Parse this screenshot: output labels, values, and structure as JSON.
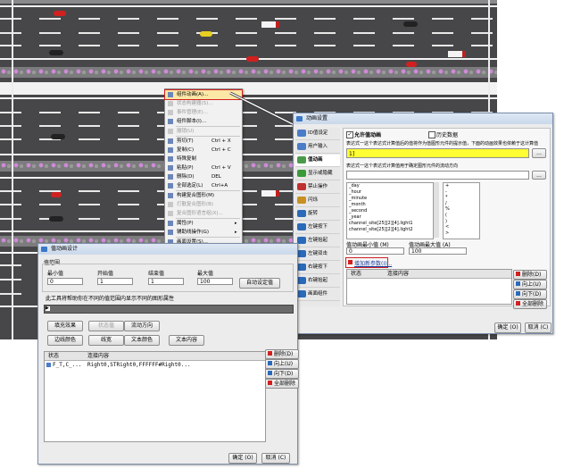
{
  "context_menu": {
    "items": [
      {
        "label": "组件动画(A)...",
        "shortcut": "",
        "enabled": true,
        "highlighted": true
      },
      {
        "label": "状态构建器(S)...",
        "shortcut": "",
        "enabled": false
      },
      {
        "label": "事件管理(E)...",
        "shortcut": "",
        "enabled": false
      },
      {
        "label": "组件脚本(I)...",
        "shortcut": "",
        "enabled": true
      },
      {
        "label": "撤销(U)",
        "shortcut": "",
        "enabled": false
      },
      {
        "label": "剪切(T)",
        "shortcut": "Ctrl + X",
        "enabled": true
      },
      {
        "label": "复制(C)",
        "shortcut": "Ctrl + C",
        "enabled": true
      },
      {
        "label": "特殊复制",
        "shortcut": "",
        "enabled": true
      },
      {
        "label": "粘贴(P)",
        "shortcut": "Ctrl + V",
        "enabled": true
      },
      {
        "label": "删除(D)",
        "shortcut": "DEL",
        "enabled": true
      },
      {
        "label": "全部选定(L)",
        "shortcut": "Ctrl+A",
        "enabled": true
      },
      {
        "label": "构建复合图形(M)",
        "shortcut": "",
        "enabled": true
      },
      {
        "label": "打散复合图形(B)",
        "shortcut": "",
        "enabled": false
      },
      {
        "label": "复合图形语言组(X)...",
        "shortcut": "",
        "enabled": false
      },
      {
        "label": "属性(P)",
        "shortcut": "",
        "enabled": true,
        "submenu": true
      },
      {
        "label": "辅助线操作(G)",
        "shortcut": "",
        "enabled": true,
        "submenu": true
      },
      {
        "label": "画面设置(S)...",
        "shortcut": "",
        "enabled": true
      }
    ]
  },
  "anim_dialog": {
    "title": "动画设置",
    "nav_items": [
      {
        "label": "ID值设定",
        "color": "#4a7cc8"
      },
      {
        "label": "用户输入",
        "color": "#4a7cc8"
      },
      {
        "label": "值动画",
        "color": "#4a9a4a",
        "selected": true
      },
      {
        "label": "显示或隐藏",
        "color": "#3a9a3a"
      },
      {
        "label": "禁止操作",
        "color": "#c03030"
      },
      {
        "label": "闪烁",
        "color": "#c89020"
      },
      {
        "label": "旋转",
        "color": "#2a6ab8"
      },
      {
        "label": "左键按下",
        "color": "#2a6ab8"
      },
      {
        "label": "左键抬起",
        "color": "#2a6ab8"
      },
      {
        "label": "左键双击",
        "color": "#2a6ab8"
      },
      {
        "label": "右键按下",
        "color": "#2a6ab8"
      },
      {
        "label": "右键抬起",
        "color": "#2a6ab8"
      },
      {
        "label": "画面组件",
        "color": "#2a6ab8"
      }
    ],
    "allow_label": "允许值动画",
    "history_label": "历史数据",
    "expr_label": "表达式一这个表达式计算值后的值将作为值图形元件的提示值，下面的动画效果也依赖于这计算值",
    "expr_value": "1]",
    "expr2_label": "表达式一这个表达式计算值用于确定图形元件的流动方向",
    "var_list": [
      "_day",
      "_hour",
      "_minute",
      "_month",
      "_second",
      "_year",
      "channel_site[25][2][4].light1",
      "channel_site[25][2][4].light2"
    ],
    "op_list": [
      "+",
      "-",
      "*",
      "/",
      "%",
      "(",
      ")",
      "<",
      ">"
    ],
    "min_label": "值动画最小值 (M)",
    "max_label": "值动画最大值 (A)",
    "min_value": "0",
    "max_value": "100",
    "add_param_label": "增加新参数(I)...",
    "param_headers": [
      "状态",
      "连接内容"
    ],
    "side_buttons": [
      "删除(D)",
      "向上(U)",
      "向下(D)",
      "全部删除"
    ],
    "ok_label": "确定 (O)",
    "cancel_label": "取消 (C)"
  },
  "value_dialog": {
    "title": "值动画设计",
    "group_label": "值范围",
    "col_labels": [
      "最小值",
      "开始值",
      "结束值",
      "最大值"
    ],
    "col_values": [
      "0",
      "1",
      "1",
      "100"
    ],
    "auto_button": "自动设定值",
    "hint": "此工具将帮助你在不同的值范围内显示不同的图形属性",
    "effect_buttons": [
      "填充效果",
      "状态值",
      "流动方向",
      "边线颜色",
      "线宽",
      "文本颜色",
      "文本内容"
    ],
    "table_headers": [
      "状态",
      "连接内容"
    ],
    "table_rows": [
      {
        "status": "F_T,C_...",
        "content": "Right0,STRight0,FFFFFF#Right0..."
      }
    ],
    "side_buttons": [
      "删除(D)",
      "向上(U)",
      "向下(D)",
      "全部删除"
    ],
    "ok_label": "确定 (O)",
    "cancel_label": "取消 (C)"
  },
  "colors": {
    "road": "#474749",
    "menu_highlight": "#fbe7a6",
    "expr_highlight": "#ffff33",
    "callout_red": "#d02020"
  }
}
